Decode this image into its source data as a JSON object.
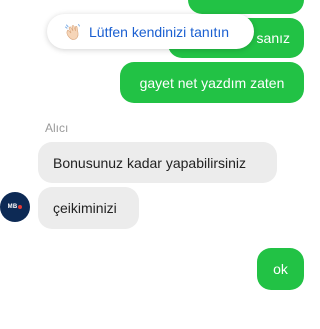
{
  "intro_chip": {
    "label": "Lütfen kendinizi tanıtın",
    "icon": "waving-hand-icon"
  },
  "messages_outgoing": [
    {
      "text": ""
    },
    {
      "text": "sanız"
    },
    {
      "text": "gayet net yazdım zaten"
    },
    {
      "text": "ok"
    }
  ],
  "sender": {
    "label": "Alıcı",
    "avatar_text": "MB"
  },
  "messages_incoming": [
    {
      "text": "Bonusunuz kadar yapabilirsiniz"
    },
    {
      "text": "çeikiminizi"
    }
  ],
  "colors": {
    "outgoing_bubble": "#22c245",
    "incoming_bubble": "#ececec",
    "chip_text": "#1a5fd1",
    "avatar_bg": "#0d2a55"
  }
}
